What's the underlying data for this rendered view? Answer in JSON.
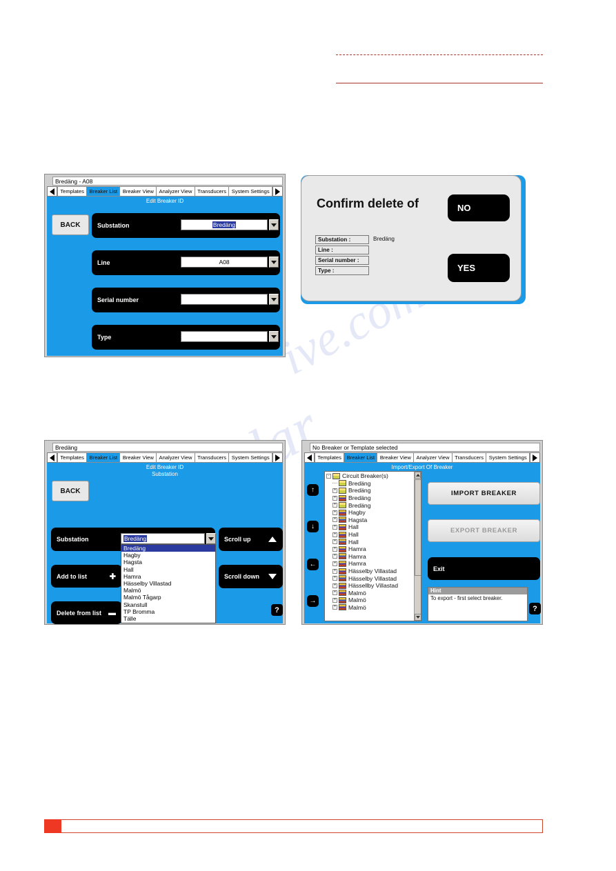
{
  "decor": {
    "accent_red": "#a33228",
    "footer_swatch": "#ef3824",
    "screen_blue": "#1b9ae8"
  },
  "tabs": [
    "Templates",
    "Breaker List",
    "Breaker View",
    "Analyzer View",
    "Transducers",
    "System Settings"
  ],
  "panel_edit": {
    "title": "Bredäng - A08",
    "active_tab": "Breaker List",
    "breadcrumb": "Edit Breaker ID",
    "back_label": "BACK",
    "rows": [
      {
        "label": "Substation",
        "value": "Bredäng",
        "selected": true
      },
      {
        "label": "Line",
        "value": "A08",
        "selected": false
      },
      {
        "label": "Serial number",
        "value": "",
        "selected": false
      },
      {
        "label": "Type",
        "value": "",
        "selected": false
      }
    ]
  },
  "panel_confirm": {
    "title": "Confirm delete of",
    "no_label": "NO",
    "yes_label": "YES",
    "fields": [
      {
        "label": "Substation :",
        "value": "Bredäng"
      },
      {
        "label": "Line :",
        "value": ""
      },
      {
        "label": "Serial number :",
        "value": ""
      },
      {
        "label": "Type :",
        "value": ""
      }
    ]
  },
  "panel_substation": {
    "title": "Bredäng",
    "active_tab": "Breaker List",
    "breadcrumb_1": "Edit Breaker ID",
    "breadcrumb_2": "Substation",
    "back_label": "BACK",
    "field_label": "Substation",
    "field_value": "Bredäng",
    "buttons": [
      {
        "label": "Add to list",
        "glyph": "✚"
      },
      {
        "label": "Delete from list",
        "glyph": "▬"
      }
    ],
    "scroll_up_label": "Scroll up",
    "scroll_down_label": "Scroll down",
    "help_label": "?",
    "dropdown_options": [
      "Bredäng",
      "Hagby",
      "Hagsta",
      "Hall",
      "Hamra",
      "Hässelby Villastad",
      "Malmö",
      "Malmö  Tågarp",
      "Skanstull",
      "TP Bromma",
      "Tälle"
    ],
    "dropdown_selected_index": 0
  },
  "panel_import_export": {
    "title": "No Breaker or Template selected",
    "active_tab": "Breaker List",
    "breadcrumb": "Import/Export Of Breaker",
    "import_label": "IMPORT BREAKER",
    "export_label": "EXPORT BREAKER",
    "export_disabled": true,
    "exit_label": "Exit",
    "help_label": "?",
    "hint_title": "Hint",
    "hint_text": "To export - first select breaker.",
    "nav_buttons": [
      "↑",
      "↓",
      "←",
      "→"
    ],
    "tree": [
      {
        "label": "Circuit Breaker(s)",
        "depth": 0,
        "toggle": "minus",
        "icon": "folder"
      },
      {
        "label": "Bredäng",
        "depth": 1,
        "toggle": "none",
        "icon": "folder"
      },
      {
        "label": "Bredäng",
        "depth": 1,
        "toggle": "plus",
        "icon": "folder"
      },
      {
        "label": "Bredäng",
        "depth": 1,
        "toggle": "plus",
        "icon": "book"
      },
      {
        "label": "Bredäng",
        "depth": 1,
        "toggle": "plus",
        "icon": "folder"
      },
      {
        "label": "Hagby",
        "depth": 1,
        "toggle": "plus",
        "icon": "book"
      },
      {
        "label": "Hagsta",
        "depth": 1,
        "toggle": "plus",
        "icon": "book2"
      },
      {
        "label": "Hall",
        "depth": 1,
        "toggle": "plus",
        "icon": "book"
      },
      {
        "label": "Hall",
        "depth": 1,
        "toggle": "plus",
        "icon": "book"
      },
      {
        "label": "Hall",
        "depth": 1,
        "toggle": "plus",
        "icon": "book2"
      },
      {
        "label": "Hamra",
        "depth": 1,
        "toggle": "plus",
        "icon": "book"
      },
      {
        "label": "Hamra",
        "depth": 1,
        "toggle": "plus",
        "icon": "book2"
      },
      {
        "label": "Hamra",
        "depth": 1,
        "toggle": "plus",
        "icon": "book"
      },
      {
        "label": "Hässelby Villastad",
        "depth": 1,
        "toggle": "plus",
        "icon": "book"
      },
      {
        "label": "Hässelby Villastad",
        "depth": 1,
        "toggle": "plus",
        "icon": "book2"
      },
      {
        "label": "Hässellby Villastad",
        "depth": 1,
        "toggle": "plus",
        "icon": "book"
      },
      {
        "label": "Malmö",
        "depth": 1,
        "toggle": "plus",
        "icon": "book"
      },
      {
        "label": "Malmö",
        "depth": 1,
        "toggle": "plus",
        "icon": "book2"
      },
      {
        "label": "Malmö",
        "depth": 1,
        "toggle": "plus",
        "icon": "book"
      }
    ]
  },
  "watermark": {
    "line1": "ive.com",
    "line2": "manualar"
  }
}
